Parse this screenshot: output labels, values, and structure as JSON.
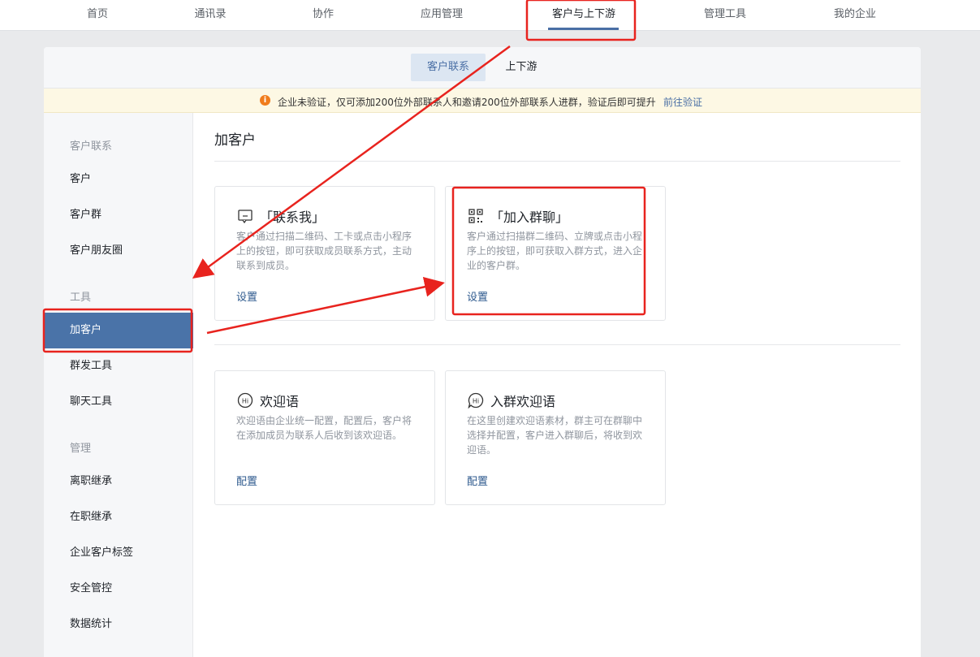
{
  "topnav": {
    "items": [
      "首页",
      "通讯录",
      "协作",
      "应用管理",
      "客户与上下游",
      "管理工具",
      "我的企业"
    ],
    "active": "客户与上下游"
  },
  "subtabs": [
    "客户联系",
    "上下游"
  ],
  "notice": {
    "text": "企业未验证，仅可添加200位外部联系人和邀请200位外部联系人进群，验证后即可提升",
    "link": "前往验证"
  },
  "sidebar": {
    "group_customer": "客户联系",
    "customer": "客户",
    "customer_group": "客户群",
    "moments": "客户朋友圈",
    "group_tools": "工具",
    "add_customer": "加客户",
    "broadcast": "群发工具",
    "chat_tools": "聊天工具",
    "group_manage": "管理",
    "resign_inherit": "离职继承",
    "onjob_inherit": "在职继承",
    "tags": "企业客户标签",
    "security": "安全管控",
    "stats": "数据统计"
  },
  "content": {
    "title": "加客户",
    "cards": {
      "contact_me": {
        "title": "「联系我」",
        "desc": "客户通过扫描二维码、工卡或点击小程序上的按钮，即可获取成员联系方式，主动联系到成员。",
        "action": "设置",
        "icon": "chat-bubble-icon"
      },
      "join_group": {
        "title": "「加入群聊」",
        "desc": "客户通过扫描群二维码、立牌或点击小程序上的按钮，即可获取入群方式，进入企业的客户群。",
        "action": "设置",
        "icon": "qr-code-icon"
      },
      "welcome": {
        "title": "欢迎语",
        "desc": "欢迎语由企业统一配置，配置后，客户将在添加成员为联系人后收到该欢迎语。",
        "action": "配置",
        "icon": "hi-icon"
      },
      "group_welcome": {
        "title": "入群欢迎语",
        "desc": "在这里创建欢迎语素材，群主可在群聊中选择并配置，客户进入群聊后，将收到欢迎语。",
        "action": "配置",
        "icon": "hi-bubble-icon"
      }
    }
  },
  "colors": {
    "accent": "#4a73a8",
    "link": "#2e5a8e",
    "annotation": "#e8231e",
    "warning": "#f07c1c"
  }
}
